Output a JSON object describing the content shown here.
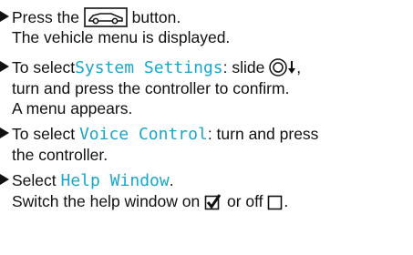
{
  "steps": [
    {
      "line1_prefix": "Press the ",
      "line1_icon": "vehicle-button-icon",
      "line1_suffix": " button.",
      "line2": "The vehicle menu is displayed."
    },
    {
      "line1_prefix": "To select",
      "line1_highlight": "System Settings",
      "line1_mid": ": slide ",
      "line1_icon": "controller-slide-down-icon",
      "line1_suffix": ",",
      "line2": "turn and press the controller to confirm.",
      "line3": "A menu appears."
    },
    {
      "line1_prefix": "To select ",
      "line1_highlight": "Voice Control",
      "line1_suffix": ": turn and press",
      "line2": "the controller."
    },
    {
      "line1_prefix": "Select ",
      "line1_highlight": "Help Window",
      "line1_suffix": ".",
      "line2_prefix": "Switch the help window on ",
      "line2_icon_on": "checkbox-checked-icon",
      "line2_mid": " or off ",
      "line2_icon_off": "checkbox-empty-icon",
      "line2_suffix": "."
    }
  ],
  "colors": {
    "highlight": "#1aa6c9",
    "text": "#111111"
  }
}
